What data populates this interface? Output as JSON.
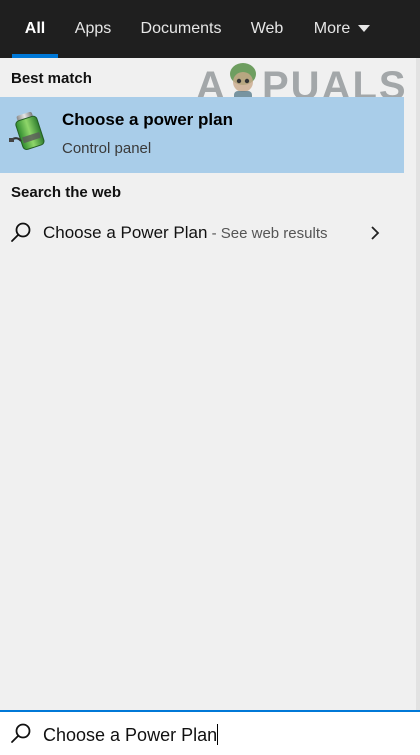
{
  "tabs": [
    {
      "label": "All",
      "active": true
    },
    {
      "label": "Apps"
    },
    {
      "label": "Documents"
    },
    {
      "label": "Web"
    },
    {
      "label": "More"
    }
  ],
  "best_match": {
    "heading": "Best match",
    "title": "Choose a power plan",
    "subtitle": "Control panel",
    "icon": "battery-icon"
  },
  "web": {
    "heading": "Search the web",
    "query": "Choose a Power Plan",
    "hint": " - See web results",
    "icon": "search-icon"
  },
  "watermark": {
    "text_left": "A",
    "text_right": "PUALS"
  },
  "search": {
    "value": "Choose a Power Plan",
    "icon": "search-icon"
  },
  "colors": {
    "tabbar_bg": "#1f1f1f",
    "accent": "#0078d7",
    "selected_bg": "#a9cde9",
    "panel_bg": "#f0f0f0"
  }
}
